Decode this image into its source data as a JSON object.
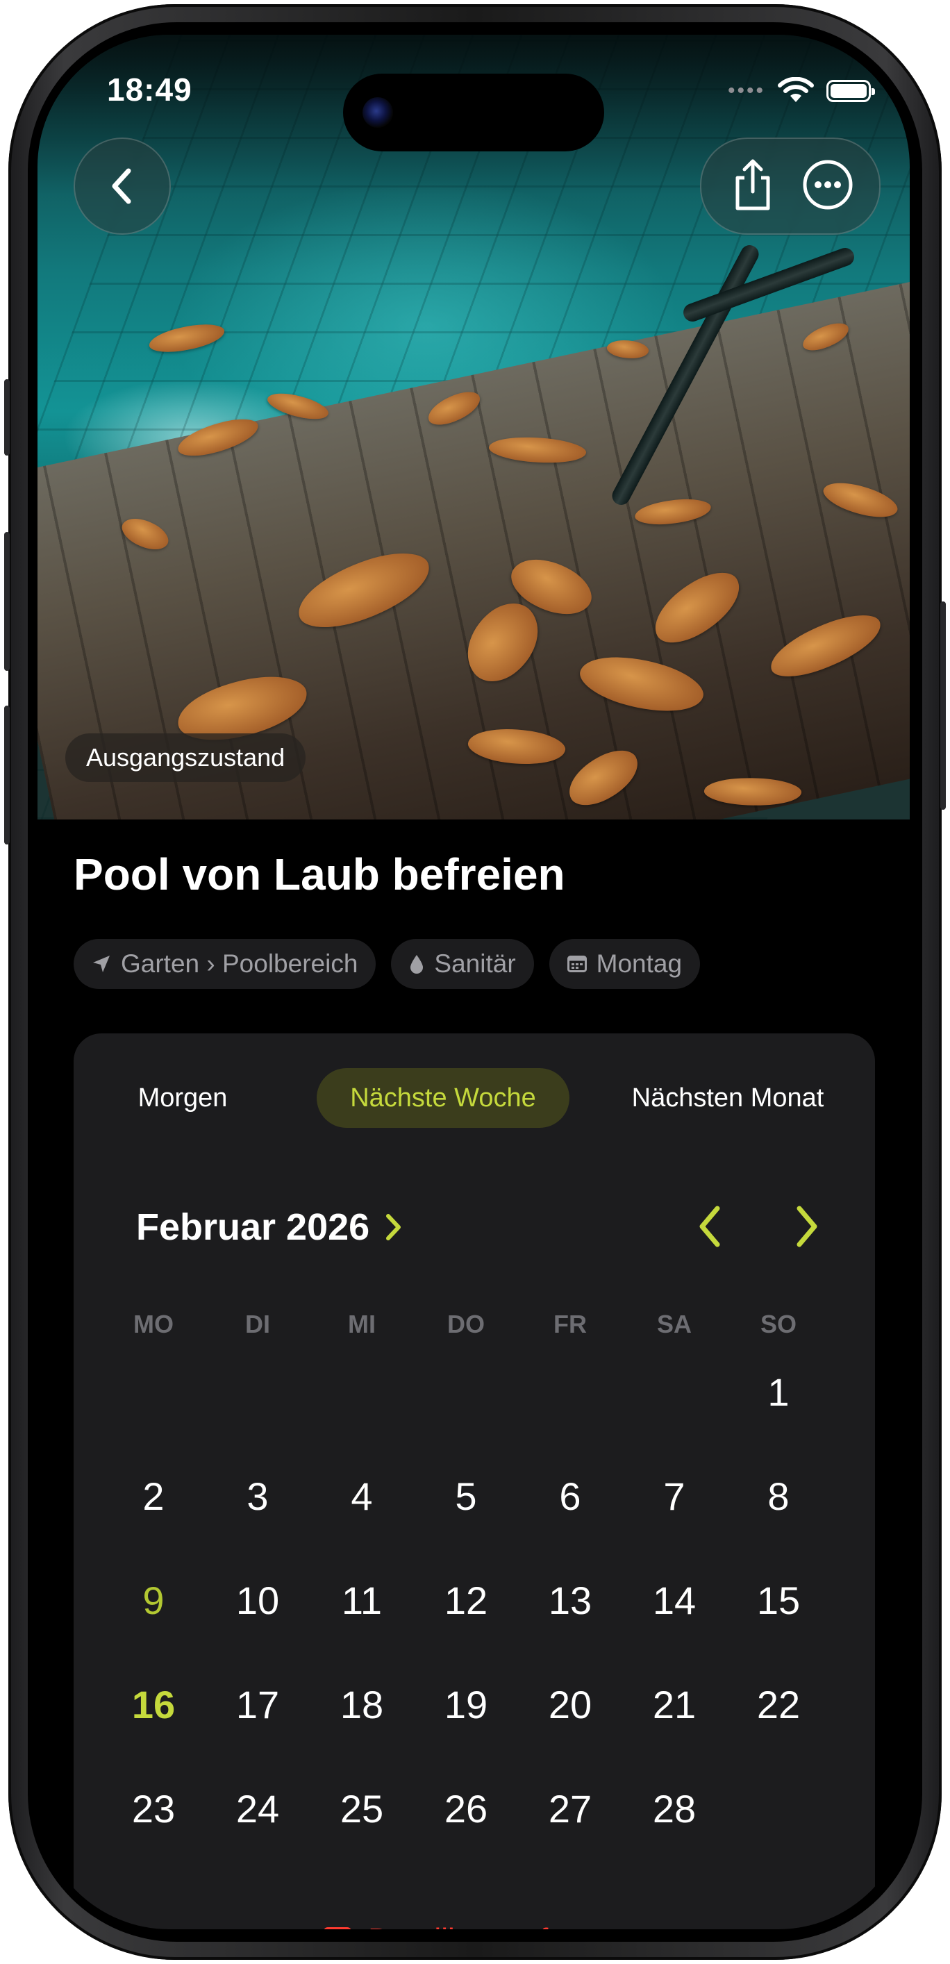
{
  "status_bar": {
    "time": "18:49",
    "signal_icon": "signal-dots-icon",
    "wifi_icon": "wifi-icon",
    "battery_icon": "battery-icon"
  },
  "hero": {
    "photo_label": "Ausgangszustand",
    "back_icon": "chevron-left-icon",
    "share_icon": "share-icon",
    "more_icon": "ellipsis-circle-icon"
  },
  "task": {
    "title": "Pool von Laub befreien",
    "chips": [
      {
        "icon": "location-arrow-icon",
        "label": "Garten › Poolbereich"
      },
      {
        "icon": "drop-icon",
        "label": "Sanitär"
      },
      {
        "icon": "calendar-icon",
        "label": "Montag"
      }
    ]
  },
  "date_picker": {
    "quick_options": [
      "Morgen",
      "Nächste Woche",
      "Nächsten Monat"
    ],
    "selected_option": "Nächste Woche",
    "month_label": "Februar 2026",
    "weekdays": [
      "MO",
      "DI",
      "MI",
      "DO",
      "FR",
      "SA",
      "SO"
    ],
    "first_weekday_index": 6,
    "days_in_month": 28,
    "today": 9,
    "selected_day": 16,
    "remove_deadline_label": "Deadline entfernen"
  },
  "colors": {
    "accent": "#c5d93c",
    "accent_bg": "#3b3d1c",
    "destructive": "#ff3b30",
    "card_bg": "#1c1c1e",
    "screen_bg": "#000000"
  }
}
